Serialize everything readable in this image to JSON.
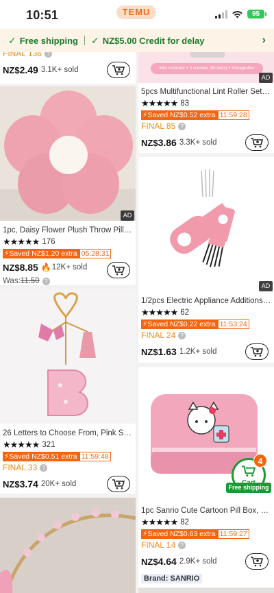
{
  "status_bar": {
    "time": "10:51",
    "brand": "TEMU",
    "battery": "95"
  },
  "banner": {
    "free_shipping": "Free shipping",
    "credit": "NZ$5.00 Credit for delay"
  },
  "left_column": [
    {
      "final": "FINAL 136",
      "currency": "NZ$",
      "price": "2.49",
      "sold": "3.1K+ sold"
    },
    {
      "title": "1pc, Daisy Flower Plush Throw Pillow...",
      "rating": "176",
      "saved": "Saved NZ$1.20 extra",
      "timer": "05:28:31",
      "currency": "NZ$",
      "price": "8.85",
      "sold": "12K+ sold",
      "was_label": "Was:",
      "was_price": "11.50",
      "ad": "AD"
    },
    {
      "title": "26 Letters to Choose From, Pink Shi...",
      "rating": "321",
      "saved": "Saved NZ$0.51 extra",
      "timer": "11:59:48",
      "final": "FINAL 33",
      "currency": "NZ$",
      "price": "3.74",
      "sold": "20K+ sold"
    }
  ],
  "right_column": [
    {
      "banner_caption": "Mini controller + 3 volumes (90 tears) + Storage Box",
      "ad": "AD",
      "title": "5pcs Multifunctional Lint Roller Set, I...",
      "rating": "83",
      "saved": "Saved NZ$0.52 extra",
      "timer": "11:59:28",
      "final": "FINAL 85",
      "currency": "NZ$",
      "price": "3.86",
      "sold": "3.3K+ sold"
    },
    {
      "title": "1/2pcs Electric Appliance Additions B...",
      "rating": "62",
      "saved": "Saved NZ$0.22 extra",
      "timer": "11:53:24",
      "final": "FINAL 24",
      "currency": "NZ$",
      "price": "1.63",
      "sold": "1.2K+ sold",
      "ad": "AD"
    },
    {
      "title": "1pc Sanrio Cute Cartoon Pill Box, 3-L...",
      "rating": "82",
      "saved": "Saved NZ$0.63 extra",
      "timer": "11:59:27",
      "final": "FINAL 14",
      "currency": "NZ$",
      "price": "4.64",
      "sold": "2.9K+ sold",
      "brand": "Brand: SANRIO"
    }
  ],
  "float_cart": {
    "count": "4",
    "label": "Cart",
    "shipping": "Free shipping"
  },
  "colors": {
    "accent": "#f5650f",
    "green": "#1a9a34",
    "final": "#f08a12"
  }
}
